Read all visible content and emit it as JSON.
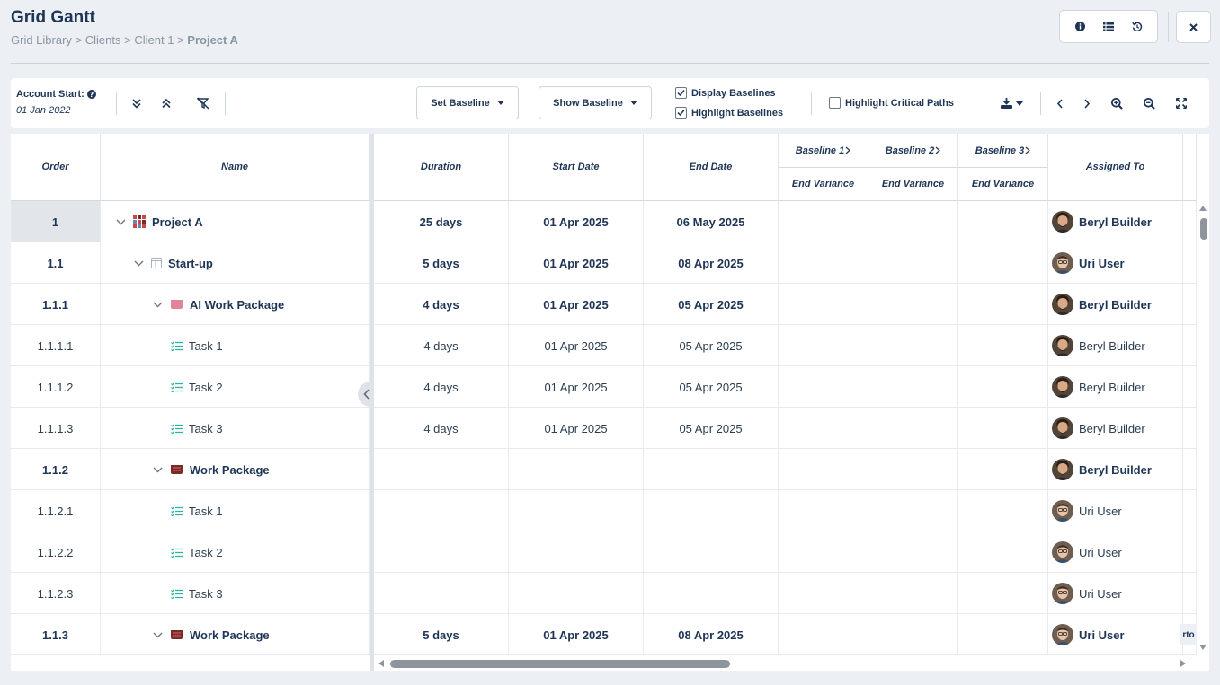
{
  "page": {
    "title": "Grid Gantt",
    "breadcrumb": [
      "Grid Library",
      "Clients",
      "Client 1",
      "Project A"
    ],
    "breadcrumb_sep": ">"
  },
  "header_icons": [
    "info-icon",
    "list-icon",
    "history-icon"
  ],
  "close_icon": "close-icon",
  "toolbar": {
    "account_start_label": "Account Start:",
    "account_start_date": "01 Jan 2022",
    "set_baseline_label": "Set Baseline",
    "show_baseline_label": "Show Baseline",
    "display_baselines_label": "Display Baselines",
    "display_baselines_checked": true,
    "highlight_baselines_label": "Highlight Baselines",
    "highlight_baselines_checked": true,
    "highlight_critical_label": "Highlight Critical Paths",
    "highlight_critical_checked": false
  },
  "columns": {
    "order": "Order",
    "name": "Name",
    "duration": "Duration",
    "start_date": "Start Date",
    "end_date": "End Date",
    "baseline1": "Baseline 1",
    "baseline2": "Baseline 2",
    "baseline3": "Baseline 3",
    "end_variance": "End Variance",
    "assigned_to": "Assigned To"
  },
  "rows": [
    {
      "order": "1",
      "name": "Project A",
      "duration": "25 days",
      "start": "01 Apr 2025",
      "end": "06 May 2025",
      "assigned": "Beryl Builder",
      "level": 0,
      "type": "project",
      "bold": true,
      "avatar": "beryl"
    },
    {
      "order": "1.1",
      "name": "Start-up",
      "duration": "5 days",
      "start": "01 Apr 2025",
      "end": "08 Apr 2025",
      "assigned": "Uri User",
      "level": 1,
      "type": "phase",
      "bold": true,
      "avatar": "uri"
    },
    {
      "order": "1.1.1",
      "name": "AI Work Package",
      "duration": "4 days",
      "start": "01 Apr 2025",
      "end": "05 Apr 2025",
      "assigned": "Beryl Builder",
      "level": 2,
      "type": "wp-pink",
      "bold": true,
      "avatar": "beryl"
    },
    {
      "order": "1.1.1.1",
      "name": "Task 1",
      "duration": "4 days",
      "start": "01 Apr 2025",
      "end": "05 Apr 2025",
      "assigned": "Beryl Builder",
      "level": 3,
      "type": "task",
      "bold": false,
      "avatar": "beryl"
    },
    {
      "order": "1.1.1.2",
      "name": "Task 2",
      "duration": "4 days",
      "start": "01 Apr 2025",
      "end": "05 Apr 2025",
      "assigned": "Beryl Builder",
      "level": 3,
      "type": "task",
      "bold": false,
      "avatar": "beryl"
    },
    {
      "order": "1.1.1.3",
      "name": "Task 3",
      "duration": "4 days",
      "start": "01 Apr 2025",
      "end": "05 Apr 2025",
      "assigned": "Beryl Builder",
      "level": 3,
      "type": "task",
      "bold": false,
      "avatar": "beryl"
    },
    {
      "order": "1.1.2",
      "name": "Work Package",
      "duration": "",
      "start": "",
      "end": "",
      "assigned": "Beryl Builder",
      "level": 2,
      "type": "wp-brown",
      "bold": true,
      "avatar": "beryl"
    },
    {
      "order": "1.1.2.1",
      "name": "Task 1",
      "duration": "",
      "start": "",
      "end": "",
      "assigned": "Uri User",
      "level": 3,
      "type": "task",
      "bold": false,
      "avatar": "uri"
    },
    {
      "order": "1.1.2.2",
      "name": "Task 2",
      "duration": "",
      "start": "",
      "end": "",
      "assigned": "Uri User",
      "level": 3,
      "type": "task",
      "bold": false,
      "avatar": "uri"
    },
    {
      "order": "1.1.2.3",
      "name": "Task 3",
      "duration": "",
      "start": "",
      "end": "",
      "assigned": "Uri User",
      "level": 3,
      "type": "task",
      "bold": false,
      "avatar": "uri"
    },
    {
      "order": "1.1.3",
      "name": "Work Package",
      "duration": "5 days",
      "start": "01 Apr 2025",
      "end": "08 Apr 2025",
      "assigned": "Uri User",
      "level": 2,
      "type": "wp-brown",
      "bold": true,
      "avatar": "uri"
    }
  ],
  "edge_tab_text": "rto",
  "colors": {
    "accent": "#1e3556",
    "task_icon": "#2fb3a3",
    "wp_pink": "#e0849a",
    "wp_brown": "#7a2a2a",
    "project_icon": "#b74a4a"
  }
}
